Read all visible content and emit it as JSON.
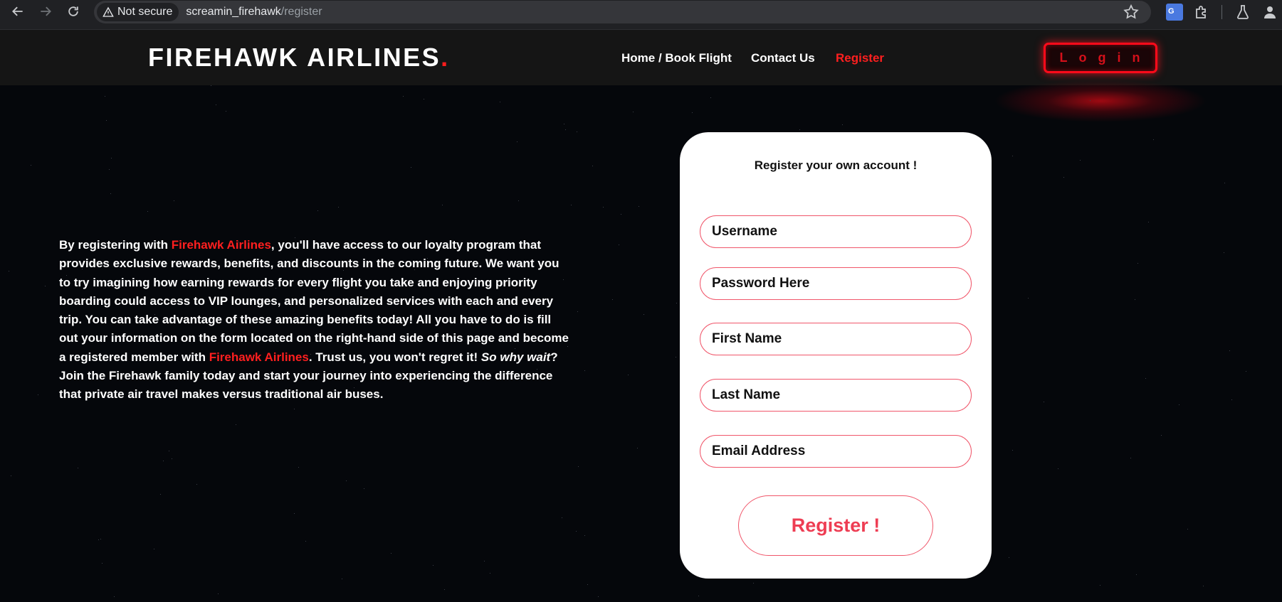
{
  "browser": {
    "security_label": "Not secure",
    "url_host": "screamin_firehawk",
    "url_path": "/register"
  },
  "header": {
    "logo_text": "FIREHAWK AIRLINES",
    "logo_dot": ".",
    "nav": {
      "home": "Home / Book Flight",
      "contact": "Contact Us",
      "register": "Register"
    },
    "login_label": "Login"
  },
  "intro": {
    "p1": "By registering with ",
    "brand": "Firehawk Airlines",
    "p2": ", you'll have access to our loyalty program that provides exclusive rewards, benefits, and discounts in the coming future. We want you to try imagining how earning rewards for every flight you take and enjoying priority boarding could access to VIP lounges, and personalized services with each and every trip. You can take advantage of these amazing benefits today! All you have to do is fill out your information on the form located on the right-hand side of this page and become a registered member with ",
    "p3": ". Trust us, you won't regret it! ",
    "emphasis": "So why wait",
    "p4": "? Join the Firehawk family today and start your journey into experiencing the difference that private air travel makes versus traditional air buses."
  },
  "form": {
    "title": "Register your own account !",
    "username_placeholder": "Username",
    "password_placeholder": "Password Here",
    "firstname_placeholder": "First Name",
    "lastname_placeholder": "Last Name",
    "email_placeholder": "Email Address",
    "submit_label": "Register !"
  },
  "colors": {
    "accent_red": "#ff1f1f",
    "field_border": "#f0566a",
    "submit_text": "#ee3d53"
  }
}
